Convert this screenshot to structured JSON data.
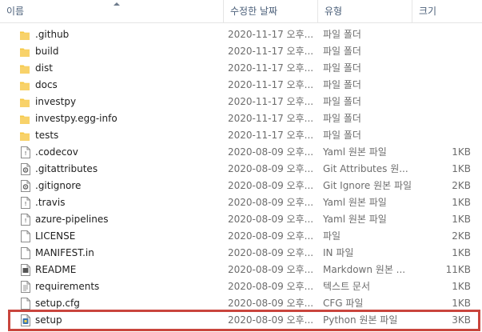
{
  "columns": {
    "name": "이름",
    "date": "수정한 날짜",
    "type": "유형",
    "size": "크기"
  },
  "colors": {
    "folder": "#f6c843",
    "highlight": "#c9453d",
    "header_text": "#4c607a"
  },
  "files": [
    {
      "name": ".github",
      "date": "2020-11-17 오후...",
      "type": "파일 폴더",
      "size": "",
      "icon": "folder-icon"
    },
    {
      "name": "build",
      "date": "2020-11-17 오후...",
      "type": "파일 폴더",
      "size": "",
      "icon": "folder-icon"
    },
    {
      "name": "dist",
      "date": "2020-11-17 오후...",
      "type": "파일 폴더",
      "size": "",
      "icon": "folder-icon"
    },
    {
      "name": "docs",
      "date": "2020-11-17 오후...",
      "type": "파일 폴더",
      "size": "",
      "icon": "folder-icon"
    },
    {
      "name": "investpy",
      "date": "2020-11-17 오후...",
      "type": "파일 폴더",
      "size": "",
      "icon": "folder-icon"
    },
    {
      "name": "investpy.egg-info",
      "date": "2020-11-17 오후...",
      "type": "파일 폴더",
      "size": "",
      "icon": "folder-icon"
    },
    {
      "name": "tests",
      "date": "2020-11-17 오후...",
      "type": "파일 폴더",
      "size": "",
      "icon": "folder-icon"
    },
    {
      "name": ".codecov",
      "date": "2020-08-09 오후...",
      "type": "Yaml 원본 파일",
      "size": "1KB",
      "icon": "yaml-file-icon"
    },
    {
      "name": ".gitattributes",
      "date": "2020-08-09 오후...",
      "type": "Git Attributes 원...",
      "size": "1KB",
      "icon": "gear-file-icon"
    },
    {
      "name": ".gitignore",
      "date": "2020-08-09 오후...",
      "type": "Git Ignore 원본 파일",
      "size": "2KB",
      "icon": "gear-file-icon"
    },
    {
      "name": ".travis",
      "date": "2020-08-09 오후...",
      "type": "Yaml 원본 파일",
      "size": "1KB",
      "icon": "yaml-file-icon"
    },
    {
      "name": "azure-pipelines",
      "date": "2020-08-09 오후...",
      "type": "Yaml 원본 파일",
      "size": "1KB",
      "icon": "yaml-file-icon"
    },
    {
      "name": "LICENSE",
      "date": "2020-08-09 오후...",
      "type": "파일",
      "size": "2KB",
      "icon": "blank-file-icon"
    },
    {
      "name": "MANIFEST.in",
      "date": "2020-08-09 오후...",
      "type": "IN 파일",
      "size": "1KB",
      "icon": "blank-file-icon"
    },
    {
      "name": "README",
      "date": "2020-08-09 오후...",
      "type": "Markdown 원본 ...",
      "size": "11KB",
      "icon": "markdown-file-icon"
    },
    {
      "name": "requirements",
      "date": "2020-08-09 오후...",
      "type": "텍스트 문서",
      "size": "1KB",
      "icon": "text-file-icon"
    },
    {
      "name": "setup.cfg",
      "date": "2020-08-09 오후...",
      "type": "CFG 파일",
      "size": "1KB",
      "icon": "blank-file-icon"
    },
    {
      "name": "setup",
      "date": "2020-08-09 오후...",
      "type": "Python 원본 파일",
      "size": "3KB",
      "icon": "python-file-icon"
    }
  ]
}
